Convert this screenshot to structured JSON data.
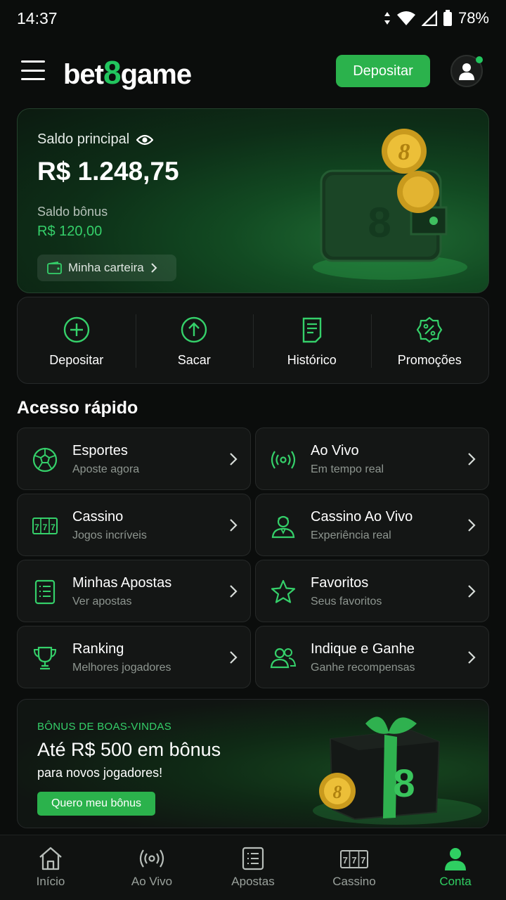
{
  "status_bar": {
    "time": "14:37",
    "battery": "78%"
  },
  "header": {
    "logo_prefix": "bet",
    "logo_eight": "8",
    "logo_suffix": "game",
    "deposit_label": "Depositar"
  },
  "balance": {
    "label": "Saldo principal",
    "amount": "R$ 1.248,75",
    "bonus_label": "Saldo bônus",
    "bonus_amount": "R$ 120,00",
    "wallet_button": "Minha carteira"
  },
  "actions": [
    {
      "label": "Depositar",
      "icon": "plus-circle-icon"
    },
    {
      "label": "Sacar",
      "icon": "arrow-up-circle-icon"
    },
    {
      "label": "Histórico",
      "icon": "document-icon"
    },
    {
      "label": "Promoções",
      "icon": "percent-badge-icon"
    }
  ],
  "quick_access": {
    "title": "Acesso rápido",
    "items": [
      {
        "title": "Esportes",
        "subtitle": "Aposte agora",
        "icon": "soccer-ball-icon"
      },
      {
        "title": "Ao Vivo",
        "subtitle": "Em tempo real",
        "icon": "broadcast-icon"
      },
      {
        "title": "Cassino",
        "subtitle": "Jogos incríveis",
        "icon": "slot-machine-icon"
      },
      {
        "title": "Cassino Ao Vivo",
        "subtitle": "Experiência real",
        "icon": "dealer-icon"
      },
      {
        "title": "Minhas Apostas",
        "subtitle": "Ver apostas",
        "icon": "list-icon"
      },
      {
        "title": "Favoritos",
        "subtitle": "Seus favoritos",
        "icon": "star-icon"
      },
      {
        "title": "Ranking",
        "subtitle": "Melhores jogadores",
        "icon": "trophy-icon"
      },
      {
        "title": "Indique e Ganhe",
        "subtitle": "Ganhe recompensas",
        "icon": "users-icon"
      }
    ]
  },
  "promo": {
    "tag": "BÔNUS DE BOAS-VINDAS",
    "title": "Até R$ 500 em bônus",
    "subtitle": "para novos jogadores!",
    "button": "Quero meu bônus"
  },
  "bottom_nav": [
    {
      "label": "Início",
      "icon": "home-icon",
      "active": false
    },
    {
      "label": "Ao Vivo",
      "icon": "broadcast-icon",
      "active": false
    },
    {
      "label": "Apostas",
      "icon": "list-icon",
      "active": false
    },
    {
      "label": "Cassino",
      "icon": "slot-machine-icon",
      "active": false
    },
    {
      "label": "Conta",
      "icon": "user-icon",
      "active": true
    }
  ],
  "colors": {
    "accent": "#2bb24c",
    "accent_text": "#35d06a",
    "background": "#0b0d0c"
  }
}
